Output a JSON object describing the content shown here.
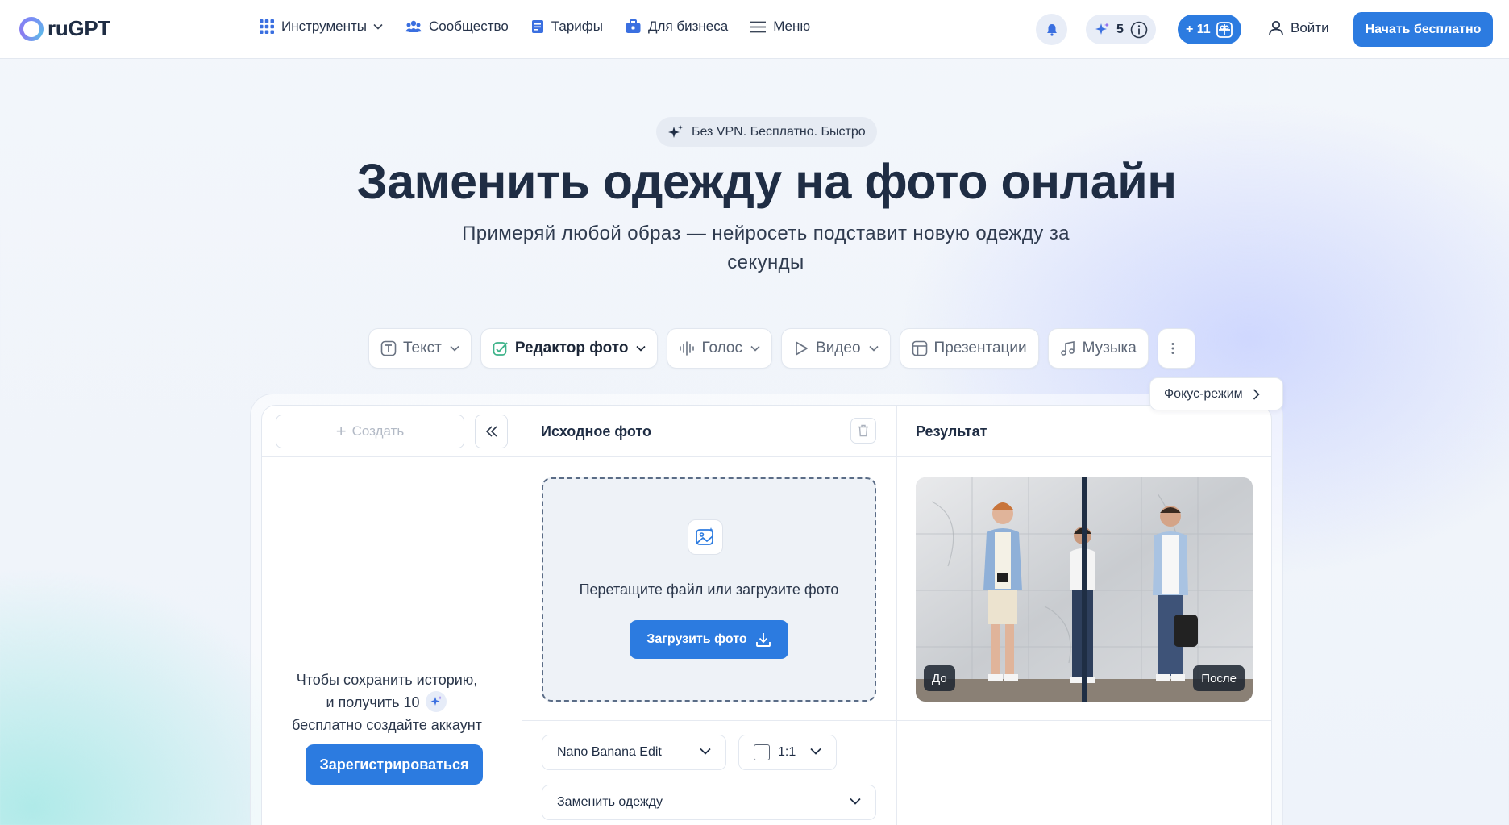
{
  "header": {
    "logo_text": "ruGPT",
    "nav": [
      {
        "label": "Инструменты",
        "icon": "grid-icon"
      },
      {
        "label": "Сообщество",
        "icon": "community-icon"
      },
      {
        "label": "Тарифы",
        "icon": "document-icon"
      },
      {
        "label": "Для бизнеса",
        "icon": "briefcase-icon"
      },
      {
        "label": "Меню",
        "icon": "hamburger-icon"
      }
    ],
    "credits_count": "5",
    "plus_label": "+ 11",
    "login_label": "Войти",
    "cta_label": "Начать бесплатно"
  },
  "hero": {
    "badge": "Без VPN. Бесплатно. Быстро",
    "title": "Заменить одежду на фото онлайн",
    "subtitle": "Примеряй любой образ — нейросеть подставит новую одежду за секунды"
  },
  "tabs": [
    {
      "label": "Текст",
      "icon": "text-icon"
    },
    {
      "label": "Редактор фото",
      "icon": "photo-edit-icon",
      "active": true
    },
    {
      "label": "Голос",
      "icon": "audio-wave-icon"
    },
    {
      "label": "Видео",
      "icon": "play-icon"
    },
    {
      "label": "Презентации",
      "icon": "layout-icon"
    },
    {
      "label": "Музыка",
      "icon": "music-icon"
    }
  ],
  "editor": {
    "focus_mode_label": "Фокус-режим",
    "create_label": "Создать",
    "save_history_text_1": "Чтобы сохранить историю, и получить 10",
    "save_history_text_2": "бесплатно создайте аккаунт",
    "register_label": "Зарегистрироваться",
    "source_title": "Исходное фото",
    "result_title": "Результат",
    "dropzone_text": "Перетащите файл или загрузите фото",
    "upload_label": "Загрузить фото",
    "before_label": "До",
    "after_label": "После",
    "model_select": "Nano Banana Edit",
    "ratio_select": "1:1",
    "action_select": "Заменить одежду"
  },
  "colors": {
    "accent": "#2c7be0",
    "text": "#1f2d44",
    "border": "#e3e8f0"
  }
}
